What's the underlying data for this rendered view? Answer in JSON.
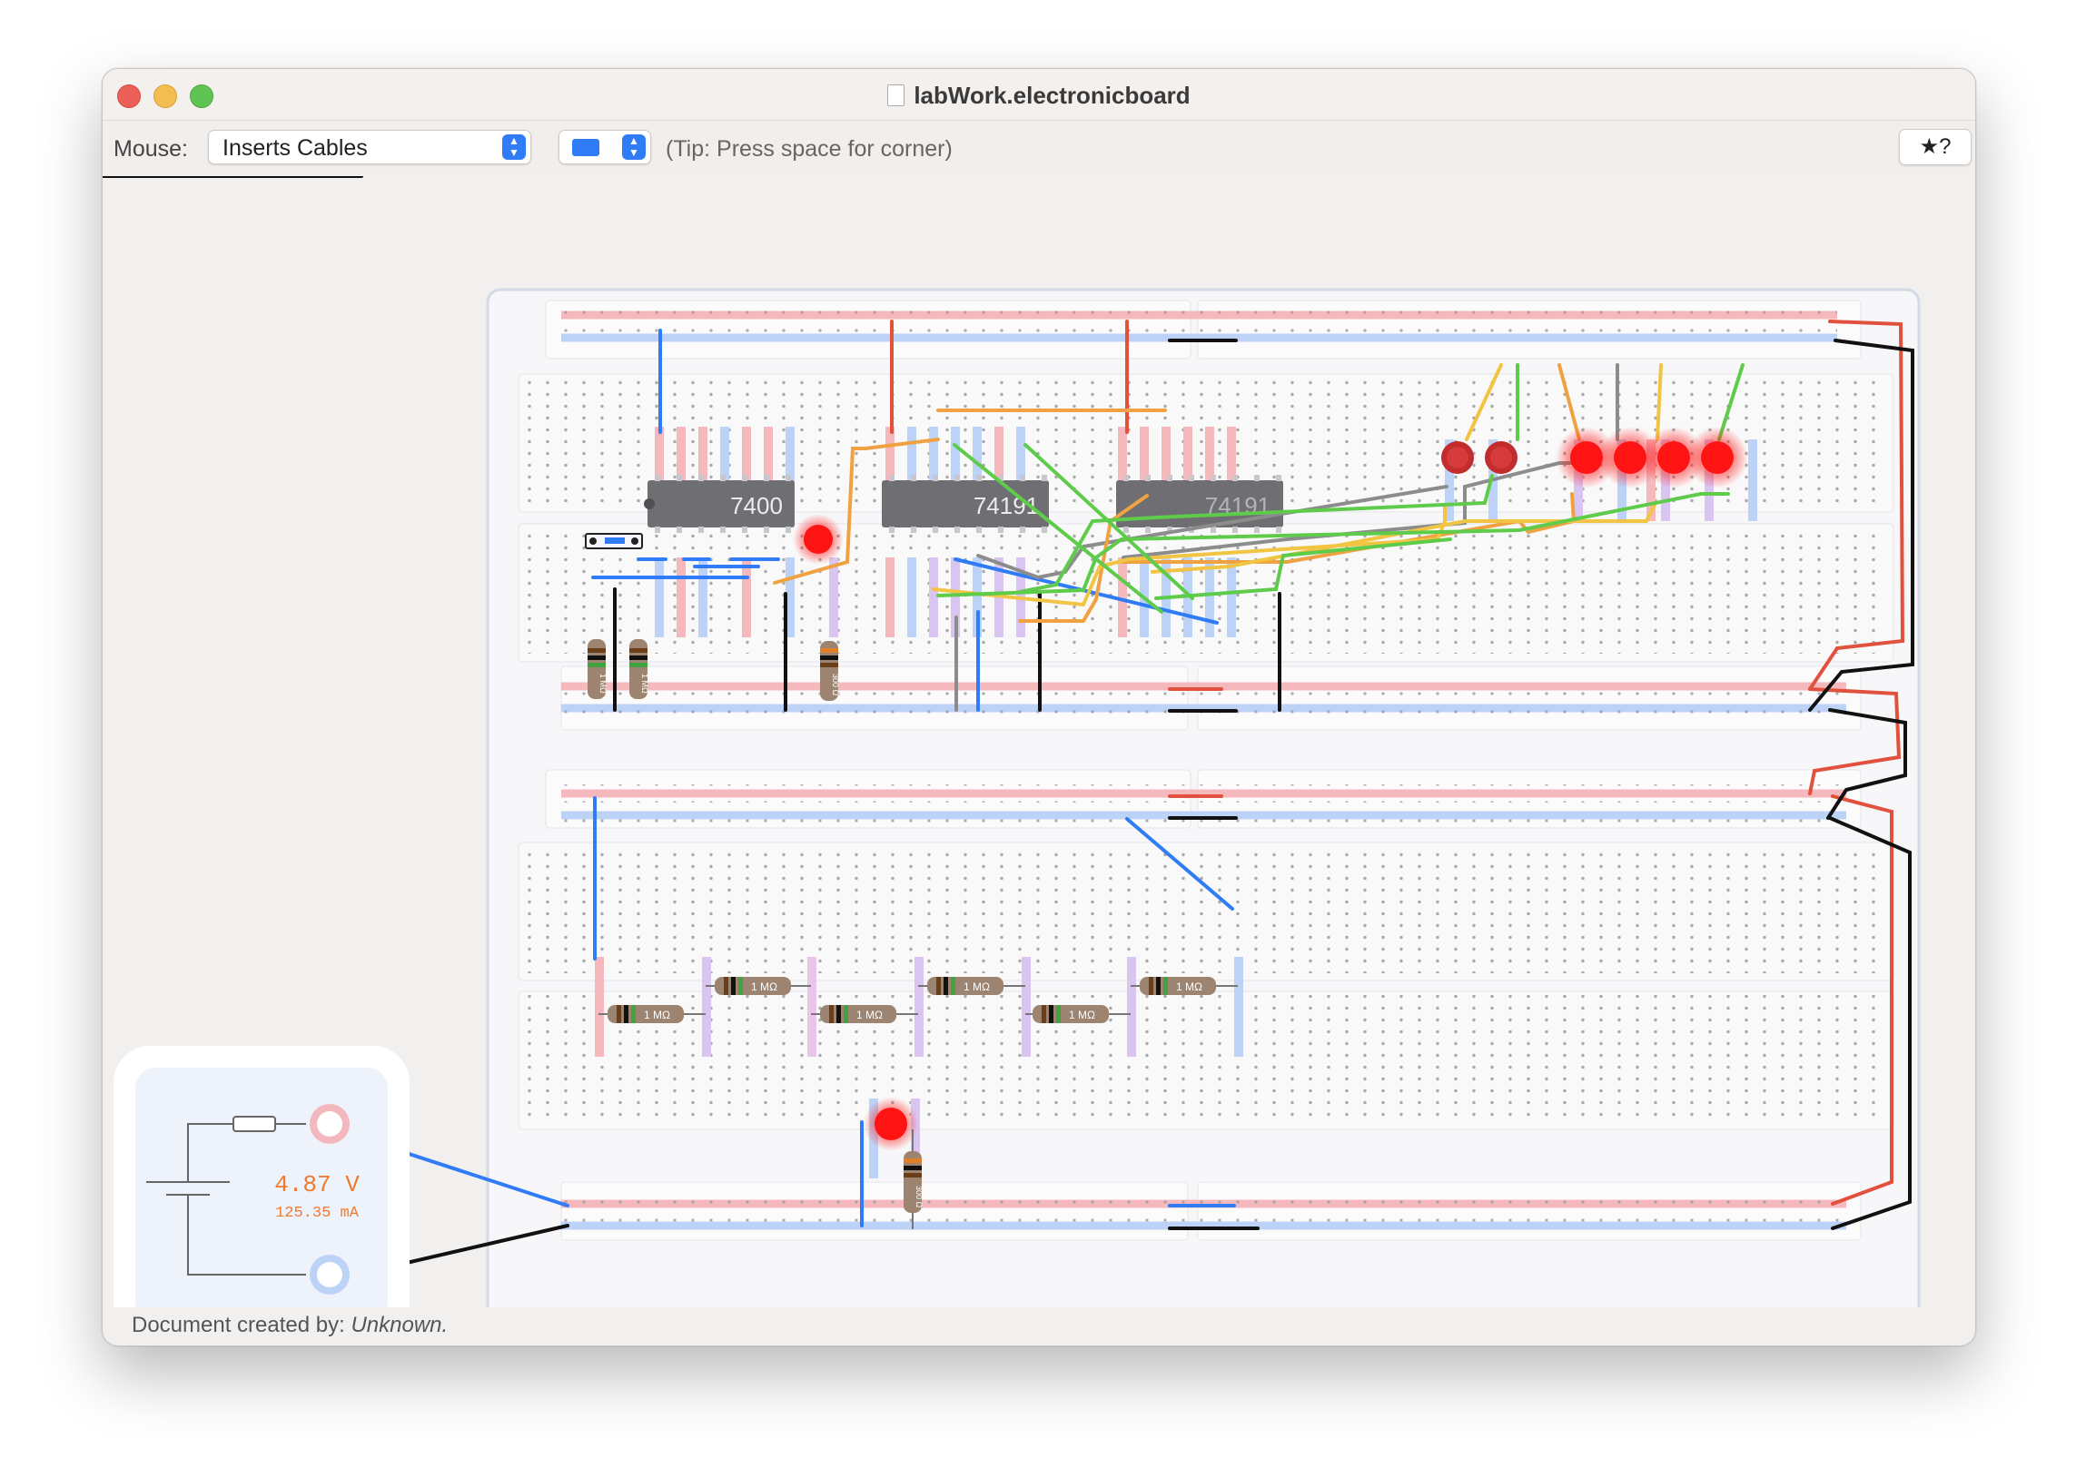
{
  "window": {
    "title": "labWork.electronicboard"
  },
  "toolbar": {
    "mouse_label": "Mouse:",
    "mouse_mode": "Inserts Cables",
    "tip": "(Tip: Press space for corner)",
    "help_label": "★?",
    "cable_color": "#2f7cf6"
  },
  "chips": [
    {
      "label": "7400"
    },
    {
      "label": "74191"
    },
    {
      "label": "74191"
    }
  ],
  "resistors": {
    "mega": "1 MΩ",
    "led": "300 Ω"
  },
  "power_supply": {
    "voltage": "4.87 V",
    "current": "125.35 mA"
  },
  "footer": {
    "prefix": "Document created by: ",
    "author": "Unknown."
  },
  "colors": {
    "wire_red": "#e2513e",
    "wire_blue": "#2f7cf6",
    "wire_black": "#111111",
    "wire_green": "#5fcb4b",
    "wire_yellow": "#f2c443",
    "wire_orange": "#f0a242",
    "wire_gray": "#8c8c8c",
    "led_red": "#ff1414",
    "rail_red": "#f5b8bd",
    "rail_blue": "#bcd3f7"
  }
}
